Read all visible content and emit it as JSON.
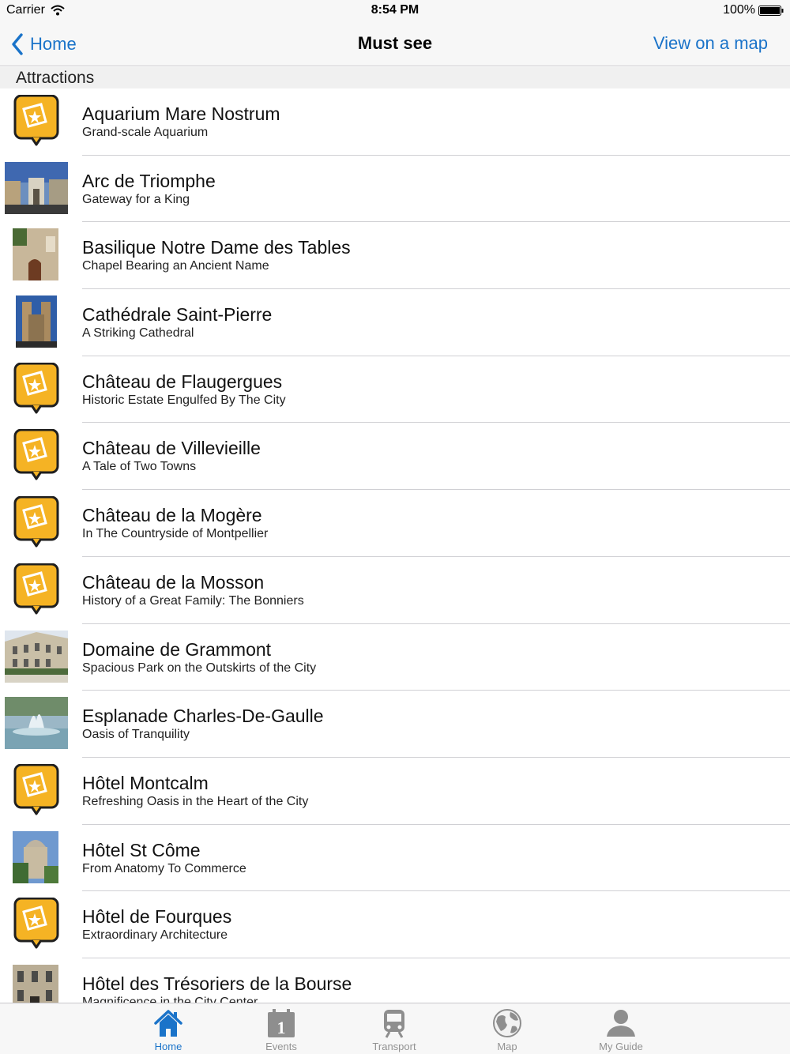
{
  "status_bar": {
    "carrier": "Carrier",
    "time": "8:54 PM",
    "battery": "100%"
  },
  "nav": {
    "back_label": "Home",
    "title": "Must see",
    "map_label": "View on a map"
  },
  "section": {
    "title": "Attractions"
  },
  "colors": {
    "accent": "#1a73c9",
    "badge_fill": "#f5b324",
    "badge_border": "#1f1f1f"
  },
  "items": [
    {
      "title": "Aquarium Mare Nostrum",
      "subtitle": "Grand-scale Aquarium",
      "thumb": "attraction-badge-icon"
    },
    {
      "title": "Arc de Triomphe",
      "subtitle": "Gateway for a King",
      "thumb": "photo"
    },
    {
      "title": "Basilique Notre Dame des Tables",
      "subtitle": "Chapel Bearing an Ancient Name",
      "thumb": "photo"
    },
    {
      "title": "Cathédrale Saint-Pierre",
      "subtitle": "A Striking Cathedral",
      "thumb": "photo"
    },
    {
      "title": "Château de Flaugergues",
      "subtitle": "Historic Estate Engulfed By The City",
      "thumb": "attraction-badge-icon"
    },
    {
      "title": "Château de Villevieille",
      "subtitle": "A Tale of Two Towns",
      "thumb": "attraction-badge-icon"
    },
    {
      "title": "Château de la Mogère",
      "subtitle": "In The Countryside of Montpellier",
      "thumb": "attraction-badge-icon"
    },
    {
      "title": "Château de la Mosson",
      "subtitle": "History of a Great Family: The Bonniers",
      "thumb": "attraction-badge-icon"
    },
    {
      "title": "Domaine de Grammont",
      "subtitle": "Spacious Park on the Outskirts of the City",
      "thumb": "photo"
    },
    {
      "title": "Esplanade Charles-De-Gaulle",
      "subtitle": "Oasis of Tranquility",
      "thumb": "photo"
    },
    {
      "title": "Hôtel Montcalm",
      "subtitle": "Refreshing Oasis in the Heart of the City",
      "thumb": "attraction-badge-icon"
    },
    {
      "title": "Hôtel St Côme",
      "subtitle": "From Anatomy To Commerce",
      "thumb": "photo"
    },
    {
      "title": "Hôtel de Fourques",
      "subtitle": "Extraordinary Architecture",
      "thumb": "attraction-badge-icon"
    },
    {
      "title": "Hôtel des Trésoriers de la Bourse",
      "subtitle": "Magnificence in the City Center",
      "thumb": "photo"
    }
  ],
  "tabs": [
    {
      "label": "Home",
      "icon": "home-icon",
      "active": true
    },
    {
      "label": "Events",
      "icon": "calendar-icon",
      "active": false
    },
    {
      "label": "Transport",
      "icon": "train-icon",
      "active": false
    },
    {
      "label": "Map",
      "icon": "globe-icon",
      "active": false
    },
    {
      "label": "My Guide",
      "icon": "user-icon",
      "active": false
    }
  ]
}
